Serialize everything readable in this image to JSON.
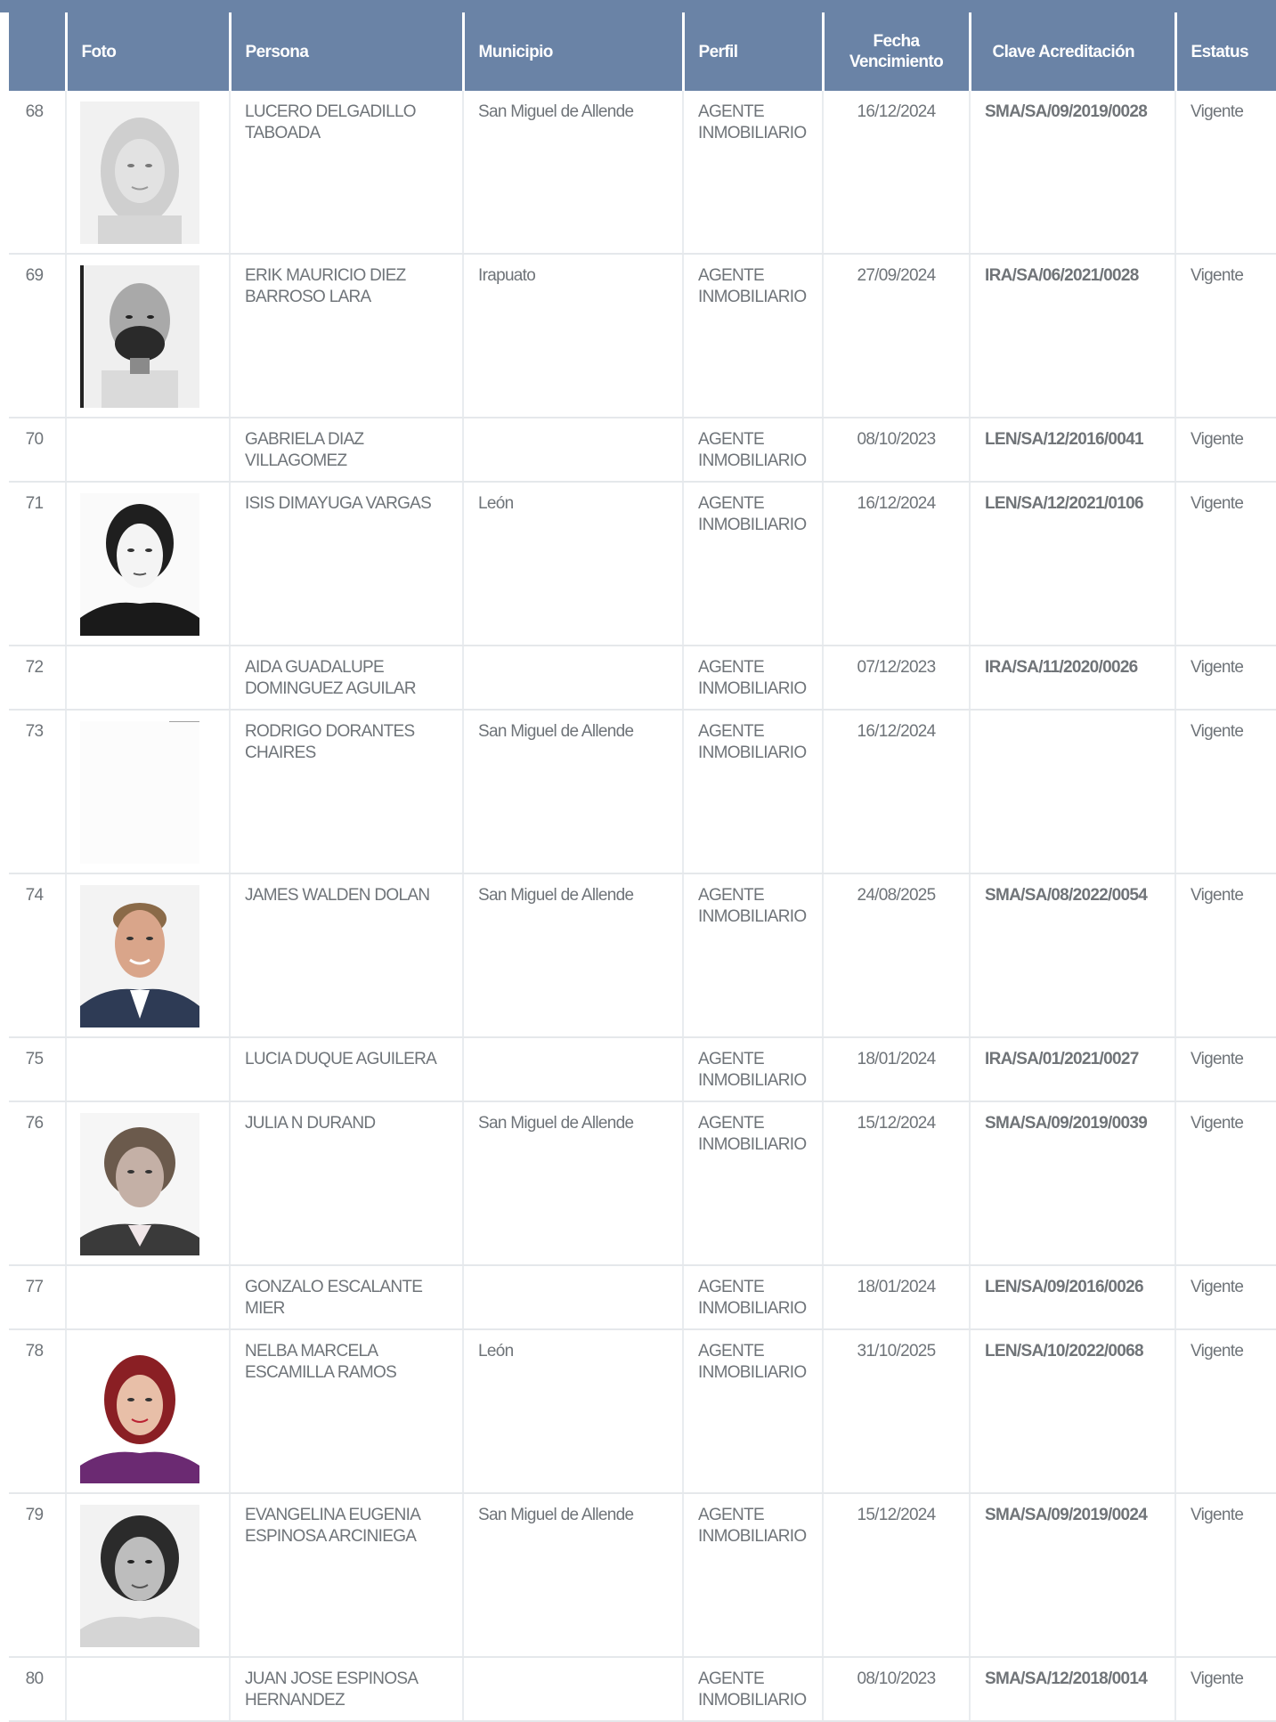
{
  "table": {
    "headers": {
      "num": "",
      "foto": "Foto",
      "persona": "Persona",
      "municipio": "Municipio",
      "perfil": "Perfil",
      "fecha_line1": "Fecha",
      "fecha_line2": "Vencimiento",
      "clave": "Clave Acreditación",
      "estatus": "Estatus"
    },
    "rows": [
      {
        "num": "68",
        "photo": "portrait-light-hair-woman",
        "persona": "LUCERO DELGADILLO TABOADA",
        "municipio": "San Miguel de Allende",
        "perfil": "AGENTE INMOBILIARIO",
        "fecha": "16/12/2024",
        "clave": "SMA/SA/09/2019/0028",
        "estatus": "Vigente"
      },
      {
        "num": "69",
        "photo": "portrait-bald-man",
        "persona": "ERIK MAURICIO DIEZ BARROSO LARA",
        "municipio": "Irapuato",
        "perfil": "AGENTE INMOBILIARIO",
        "fecha": "27/09/2024",
        "clave": "IRA/SA/06/2021/0028",
        "estatus": "Vigente"
      },
      {
        "num": "70",
        "photo": "",
        "persona": "GABRIELA DIAZ VILLAGOMEZ",
        "municipio": "",
        "perfil": "AGENTE INMOBILIARIO",
        "fecha": "08/10/2023",
        "clave": "LEN/SA/12/2016/0041",
        "estatus": "Vigente"
      },
      {
        "num": "71",
        "photo": "portrait-dark-hair-woman",
        "persona": "ISIS DIMAYUGA VARGAS",
        "municipio": "León",
        "perfil": "AGENTE INMOBILIARIO",
        "fecha": "16/12/2024",
        "clave": "LEN/SA/12/2021/0106",
        "estatus": "Vigente"
      },
      {
        "num": "72",
        "photo": "",
        "persona": "AIDA GUADALUPE DOMINGUEZ AGUILAR",
        "municipio": "",
        "perfil": "AGENTE INMOBILIARIO",
        "fecha": "07/12/2023",
        "clave": "IRA/SA/11/2020/0026",
        "estatus": "Vigente"
      },
      {
        "num": "73",
        "photo": "portrait-blank",
        "persona": "RODRIGO DORANTES CHAIRES",
        "municipio": "San Miguel de Allende",
        "perfil": "AGENTE INMOBILIARIO",
        "fecha": "16/12/2024",
        "clave": "",
        "estatus": "Vigente"
      },
      {
        "num": "74",
        "photo": "portrait-man-suit",
        "persona": "JAMES WALDEN DOLAN",
        "municipio": "San Miguel de Allende",
        "perfil": "AGENTE INMOBILIARIO",
        "fecha": "24/08/2025",
        "clave": "SMA/SA/08/2022/0054",
        "estatus": "Vigente"
      },
      {
        "num": "75",
        "photo": "",
        "persona": "LUCIA DUQUE AGUILERA",
        "municipio": "",
        "perfil": "AGENTE INMOBILIARIO",
        "fecha": "18/01/2024",
        "clave": "IRA/SA/01/2021/0027",
        "estatus": "Vigente"
      },
      {
        "num": "76",
        "photo": "portrait-older-woman",
        "persona": "JULIA N DURAND",
        "municipio": "San Miguel de Allende",
        "perfil": "AGENTE INMOBILIARIO",
        "fecha": "15/12/2024",
        "clave": "SMA/SA/09/2019/0039",
        "estatus": "Vigente"
      },
      {
        "num": "77",
        "photo": "",
        "persona": "GONZALO ESCALANTE MIER",
        "municipio": "",
        "perfil": "AGENTE INMOBILIARIO",
        "fecha": "18/01/2024",
        "clave": "LEN/SA/09/2016/0026",
        "estatus": "Vigente"
      },
      {
        "num": "78",
        "photo": "portrait-red-hair-woman",
        "persona": "NELBA MARCELA ESCAMILLA RAMOS",
        "municipio": "León",
        "perfil": "AGENTE INMOBILIARIO",
        "fecha": "31/10/2025",
        "clave": "LEN/SA/10/2022/0068",
        "estatus": "Vigente"
      },
      {
        "num": "79",
        "photo": "portrait-brunette-woman",
        "persona": "EVANGELINA EUGENIA ESPINOSA ARCINIEGA",
        "municipio": "San Miguel de Allende",
        "perfil": "AGENTE INMOBILIARIO",
        "fecha": "15/12/2024",
        "clave": "SMA/SA/09/2019/0024",
        "estatus": "Vigente"
      },
      {
        "num": "80",
        "photo": "",
        "persona": "JUAN JOSE ESPINOSA HERNANDEZ",
        "municipio": "",
        "perfil": "AGENTE INMOBILIARIO",
        "fecha": "08/10/2023",
        "clave": "SMA/SA/12/2018/0014",
        "estatus": "Vigente"
      }
    ]
  }
}
